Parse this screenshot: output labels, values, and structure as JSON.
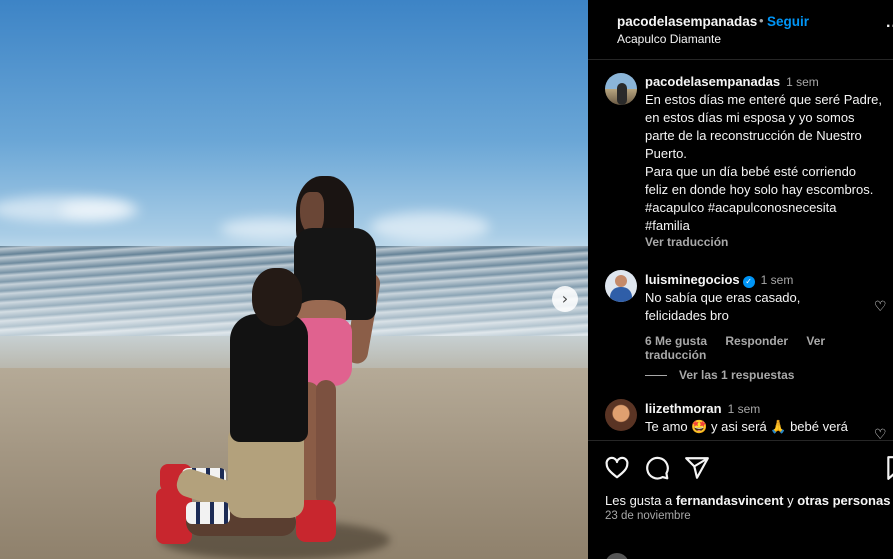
{
  "post": {
    "username": "pacodelasempanadas",
    "follow_label": "Seguir",
    "dot": "•",
    "location": "Acapulco Diamante",
    "more_label": "..."
  },
  "caption": {
    "username": "pacodelasempanadas",
    "time": "1 sem",
    "lines": [
      "En estos días me enteré que seré Padre,",
      "en estos días mi esposa y yo somos",
      "parte de la reconstrucción de Nuestro",
      "Puerto.",
      "Para que un día bebé esté corriendo",
      "feliz en donde hoy solo hay escombros.",
      "#acapulco #acapulconosnecesita",
      "#familia"
    ],
    "translate_label": "Ver traducción"
  },
  "comments": [
    {
      "username": "luisminegocios",
      "verified": true,
      "time": "1 sem",
      "lines": [
        "No sabía que eras casado,",
        "felicidades bro"
      ],
      "likes": "6 Me gusta",
      "reply_label": "Responder",
      "translate_label": "Ver traducción",
      "replies_label": "Ver las 1 respuestas"
    },
    {
      "username": "liizethmoran",
      "time": "1 sem",
      "text": "Te amo 🤩 y asi será 🙏 bebé verá"
    }
  ],
  "footer": {
    "likes_prefix": "Les gusta a ",
    "likes_user": "fernandasvincent",
    "likes_mid": " y ",
    "likes_others": "otras personas",
    "date": "23 de noviembre"
  },
  "icons": {
    "next": "›",
    "heart": "♡",
    "verified": "✓"
  }
}
